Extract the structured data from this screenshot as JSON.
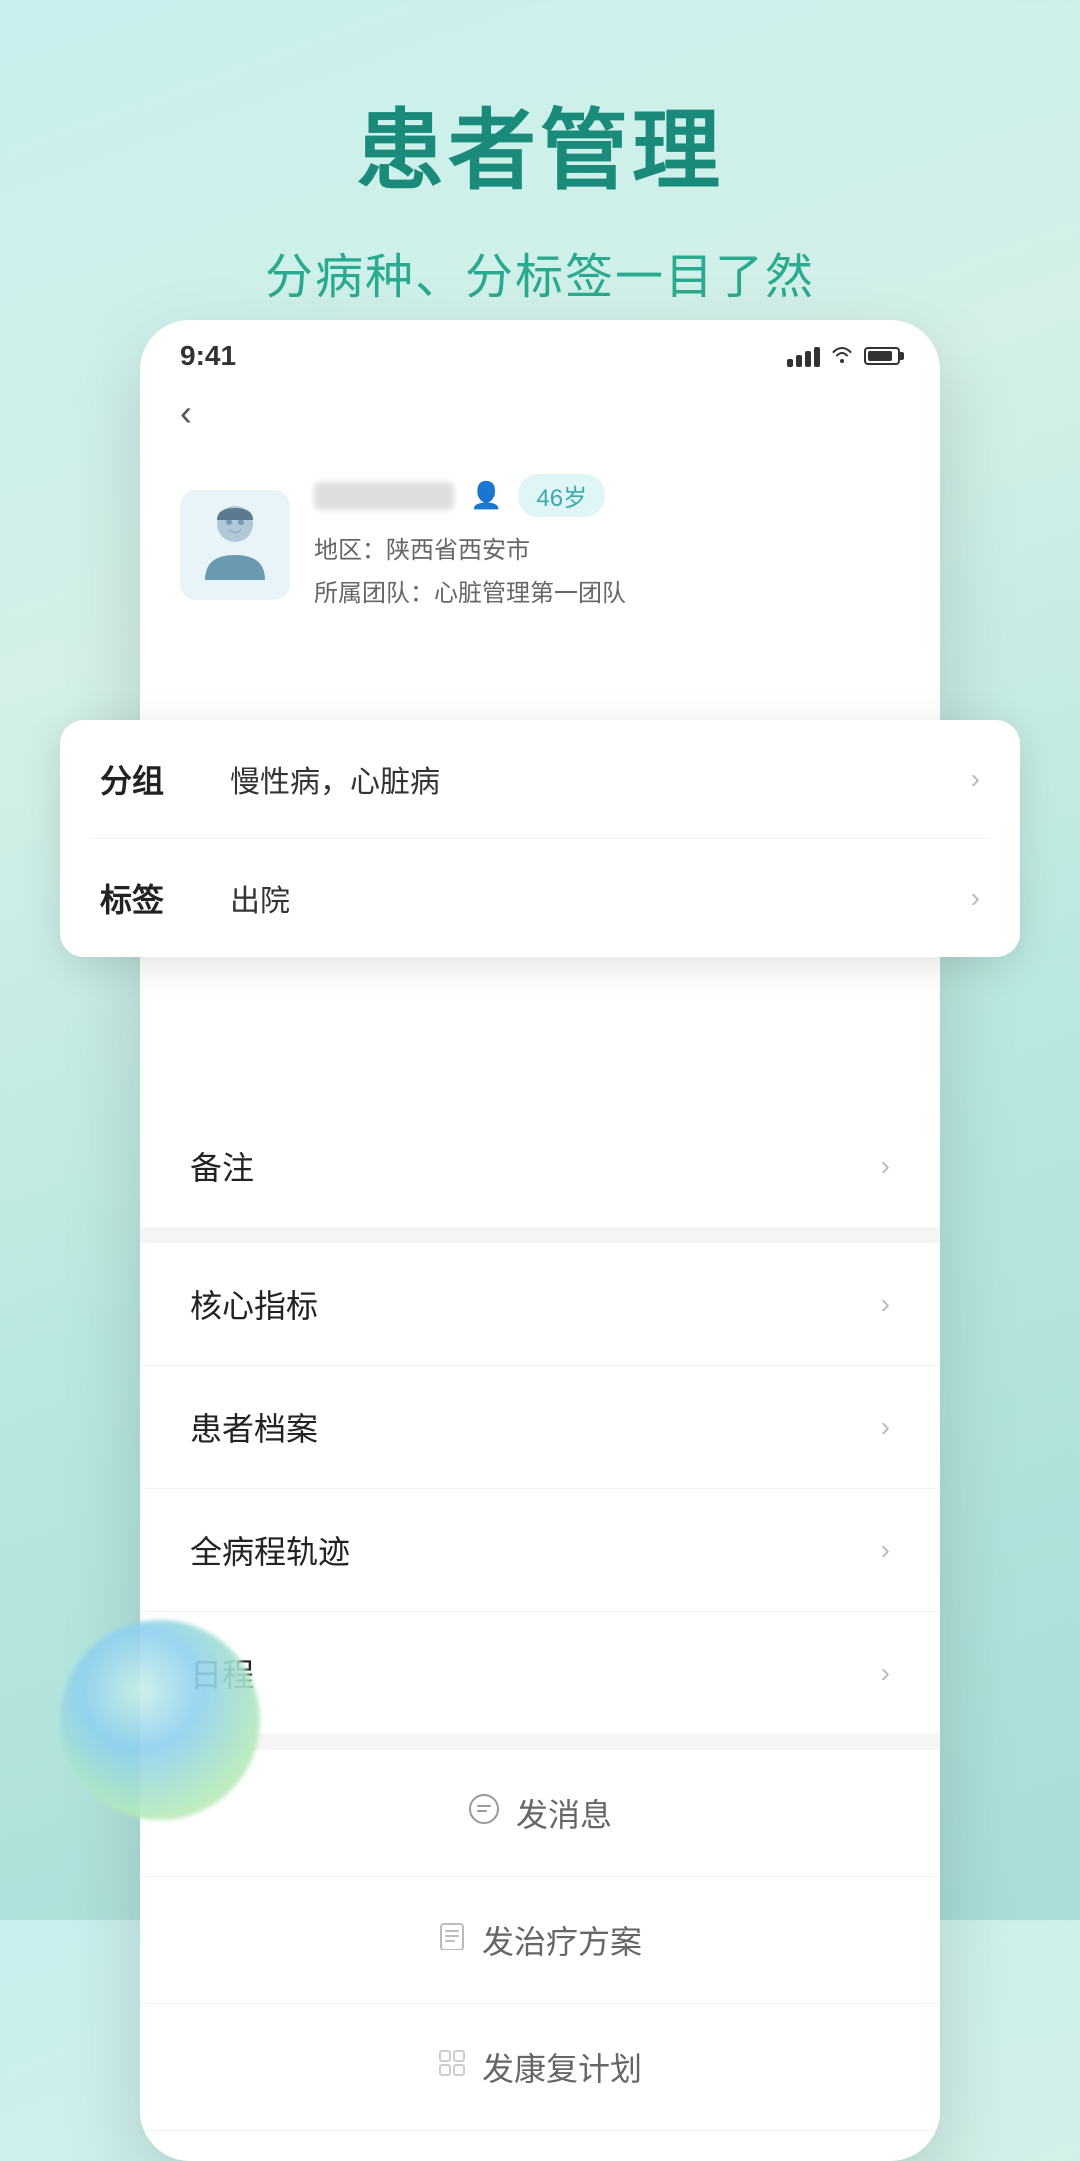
{
  "page": {
    "title": "患者管理",
    "subtitle": "分病种、分标签一目了然"
  },
  "status_bar": {
    "time": "9:41"
  },
  "patient": {
    "age_badge": "46岁",
    "region_label": "地区：",
    "region_value": "陕西省西安市",
    "team_label": "所属团队：",
    "team_value": "心脏管理第一团队"
  },
  "float_card": {
    "group_label": "分组",
    "group_value": "慢性病，心脏病",
    "tag_label": "标签",
    "tag_value": "出院"
  },
  "menu_section1": [
    {
      "label": "备注"
    }
  ],
  "menu_section2": [
    {
      "label": "核心指标"
    },
    {
      "label": "患者档案"
    },
    {
      "label": "全病程轨迹"
    },
    {
      "label": "日程"
    }
  ],
  "actions": [
    {
      "label": "发消息",
      "icon": "💬"
    },
    {
      "label": "发治疗方案",
      "icon": "📋"
    },
    {
      "label": "发康复计划",
      "icon": "🔲"
    }
  ]
}
